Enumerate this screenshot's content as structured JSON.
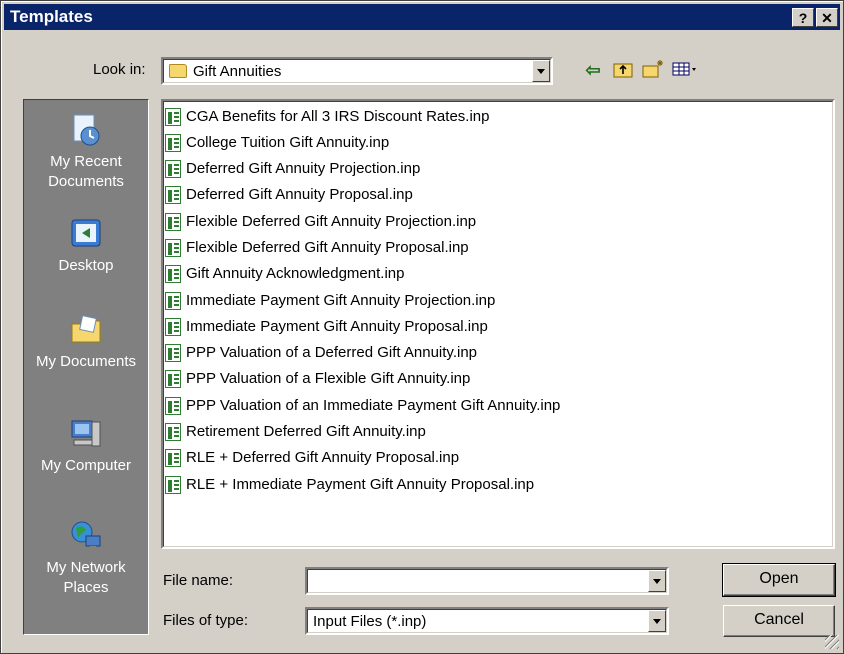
{
  "window": {
    "title": "Templates",
    "help_label": "?",
    "close_label": "✕"
  },
  "toolbar": {
    "look_in_label": "Look in:",
    "look_in_value": "Gift Annuities",
    "icons": [
      "back-arrow-icon",
      "up-folder-icon",
      "new-folder-icon",
      "view-menu-icon"
    ]
  },
  "places": [
    {
      "label": "My Recent Documents",
      "icon": "recent-documents-icon"
    },
    {
      "label": "Desktop",
      "icon": "desktop-icon"
    },
    {
      "label": "My Documents",
      "icon": "my-documents-icon"
    },
    {
      "label": "My Computer",
      "icon": "my-computer-icon"
    },
    {
      "label": "My Network Places",
      "icon": "network-places-icon"
    }
  ],
  "files": [
    "CGA Benefits for All 3 IRS Discount Rates.inp",
    "College Tuition Gift Annuity.inp",
    "Deferred Gift Annuity Projection.inp",
    "Deferred Gift Annuity Proposal.inp",
    "Flexible Deferred Gift Annuity Projection.inp",
    "Flexible Deferred Gift Annuity Proposal.inp",
    "Gift Annuity Acknowledgment.inp",
    "Immediate Payment Gift Annuity Projection.inp",
    "Immediate Payment Gift Annuity Proposal.inp",
    "PPP Valuation of a Deferred Gift Annuity.inp",
    "PPP Valuation of a Flexible Gift Annuity.inp",
    "PPP Valuation of an Immediate Payment Gift Annuity.inp",
    "Retirement Deferred Gift Annuity.inp",
    "RLE + Deferred Gift Annuity Proposal.inp",
    "RLE + Immediate Payment Gift Annuity Proposal.inp"
  ],
  "footer": {
    "file_name_label": "File name:",
    "file_name_value": "",
    "file_type_label": "Files of type:",
    "file_type_value": "Input Files (*.inp)",
    "open_label": "Open",
    "cancel_label": "Cancel"
  }
}
